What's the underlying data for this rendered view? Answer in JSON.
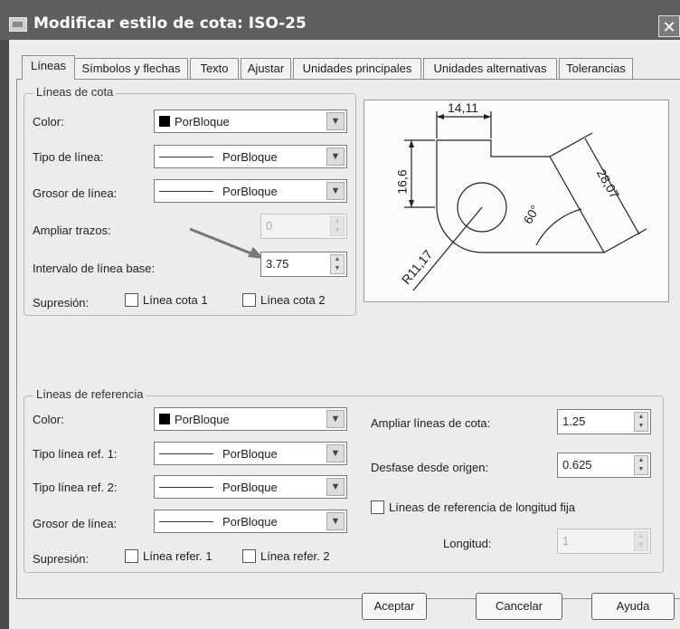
{
  "window": {
    "title": "Modificar estilo de cota: ISO-25",
    "close": "✕"
  },
  "tabs": [
    "Líneas",
    "Símbolos y flechas",
    "Texto",
    "Ajustar",
    "Unidades principales",
    "Unidades alternativas",
    "Tolerancias"
  ],
  "cota": {
    "legend": "Líneas de cota",
    "color_label": "Color:",
    "color_value": "PorBloque",
    "tipo_label": "Tipo de línea:",
    "tipo_value": "PorBloque",
    "grosor_label": "Grosor de línea:",
    "grosor_value": "PorBloque",
    "ampliar_label": "Ampliar trazos:",
    "ampliar_value": "0",
    "intervalo_label": "Intervalo de línea base:",
    "intervalo_value": "3.75",
    "supresion_label": "Supresión:",
    "sup1": "Línea cota 1",
    "sup2": "Línea cota 2"
  },
  "preview": {
    "dim_top": "14,11",
    "dim_left": "16,6",
    "dim_diag": "28,07",
    "dim_angle": "60°",
    "dim_radius": "R11,17"
  },
  "ref": {
    "legend": "Líneas de referencia",
    "color_label": "Color:",
    "color_value": "PorBloque",
    "tipo1_label": "Tipo línea ref. 1:",
    "tipo1_value": "PorBloque",
    "tipo2_label": "Tipo línea ref. 2:",
    "tipo2_value": "PorBloque",
    "grosor_label": "Grosor de línea:",
    "grosor_value": "PorBloque",
    "supresion_label": "Supresión:",
    "sup1": "Línea refer. 1",
    "sup2": "Línea refer. 2",
    "ampliar_label": "Ampliar líneas de cota:",
    "ampliar_value": "1.25",
    "desfase_label": "Desfase desde origen:",
    "desfase_value": "0.625",
    "fija_label": "Líneas de referencia de longitud fija",
    "longitud_label": "Longitud:",
    "longitud_value": "1"
  },
  "buttons": {
    "ok": "Aceptar",
    "cancel": "Cancelar",
    "help": "Ayuda"
  },
  "icons": {
    "arrow": "chevron-down-icon",
    "spin": "spin-arrows-icon"
  }
}
